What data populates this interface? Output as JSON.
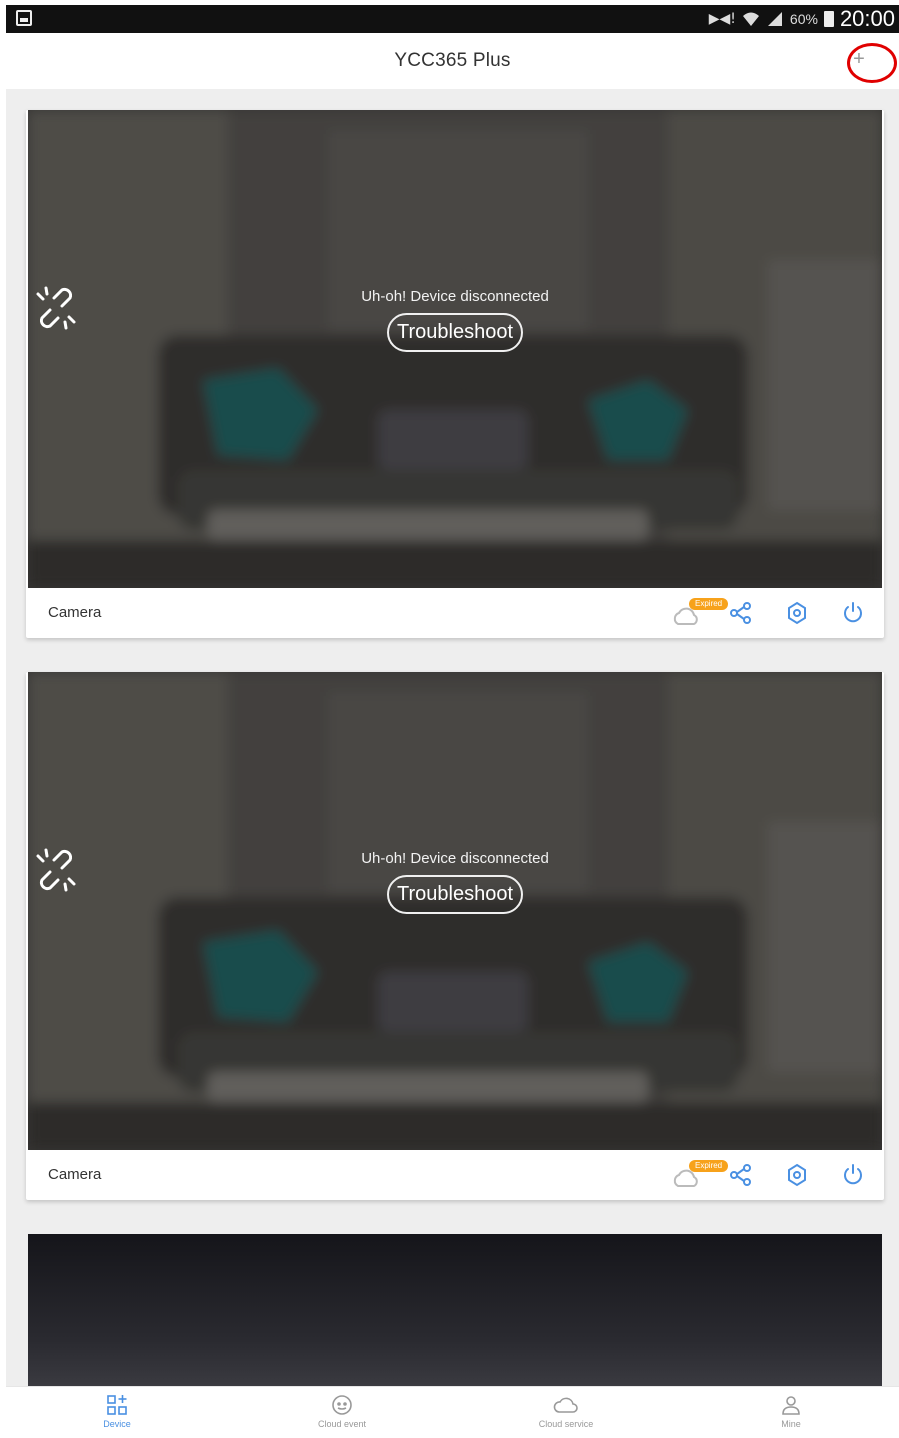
{
  "status_bar": {
    "signal_text": "▶◀!",
    "battery_percent": "60%",
    "time": "20:00"
  },
  "app_bar": {
    "title": "YCC365 Plus",
    "add_label": "+"
  },
  "devices": [
    {
      "name": "Camera",
      "status_text": "Uh-oh! Device disconnected",
      "action_label": "Troubleshoot",
      "cloud_badge": "Expired"
    },
    {
      "name": "Camera",
      "status_text": "Uh-oh! Device disconnected",
      "action_label": "Troubleshoot",
      "cloud_badge": "Expired"
    }
  ],
  "bottom_nav": [
    {
      "label": "Device",
      "icon": "device-icon",
      "active": true
    },
    {
      "label": "Cloud event",
      "icon": "cloud-event-icon",
      "active": false
    },
    {
      "label": "Cloud service",
      "icon": "cloud-service-icon",
      "active": false
    },
    {
      "label": "Mine",
      "icon": "person-icon",
      "active": false
    }
  ],
  "colors": {
    "accent": "#4a90e2",
    "badge": "#f7a21b",
    "annotation": "#e00000"
  }
}
